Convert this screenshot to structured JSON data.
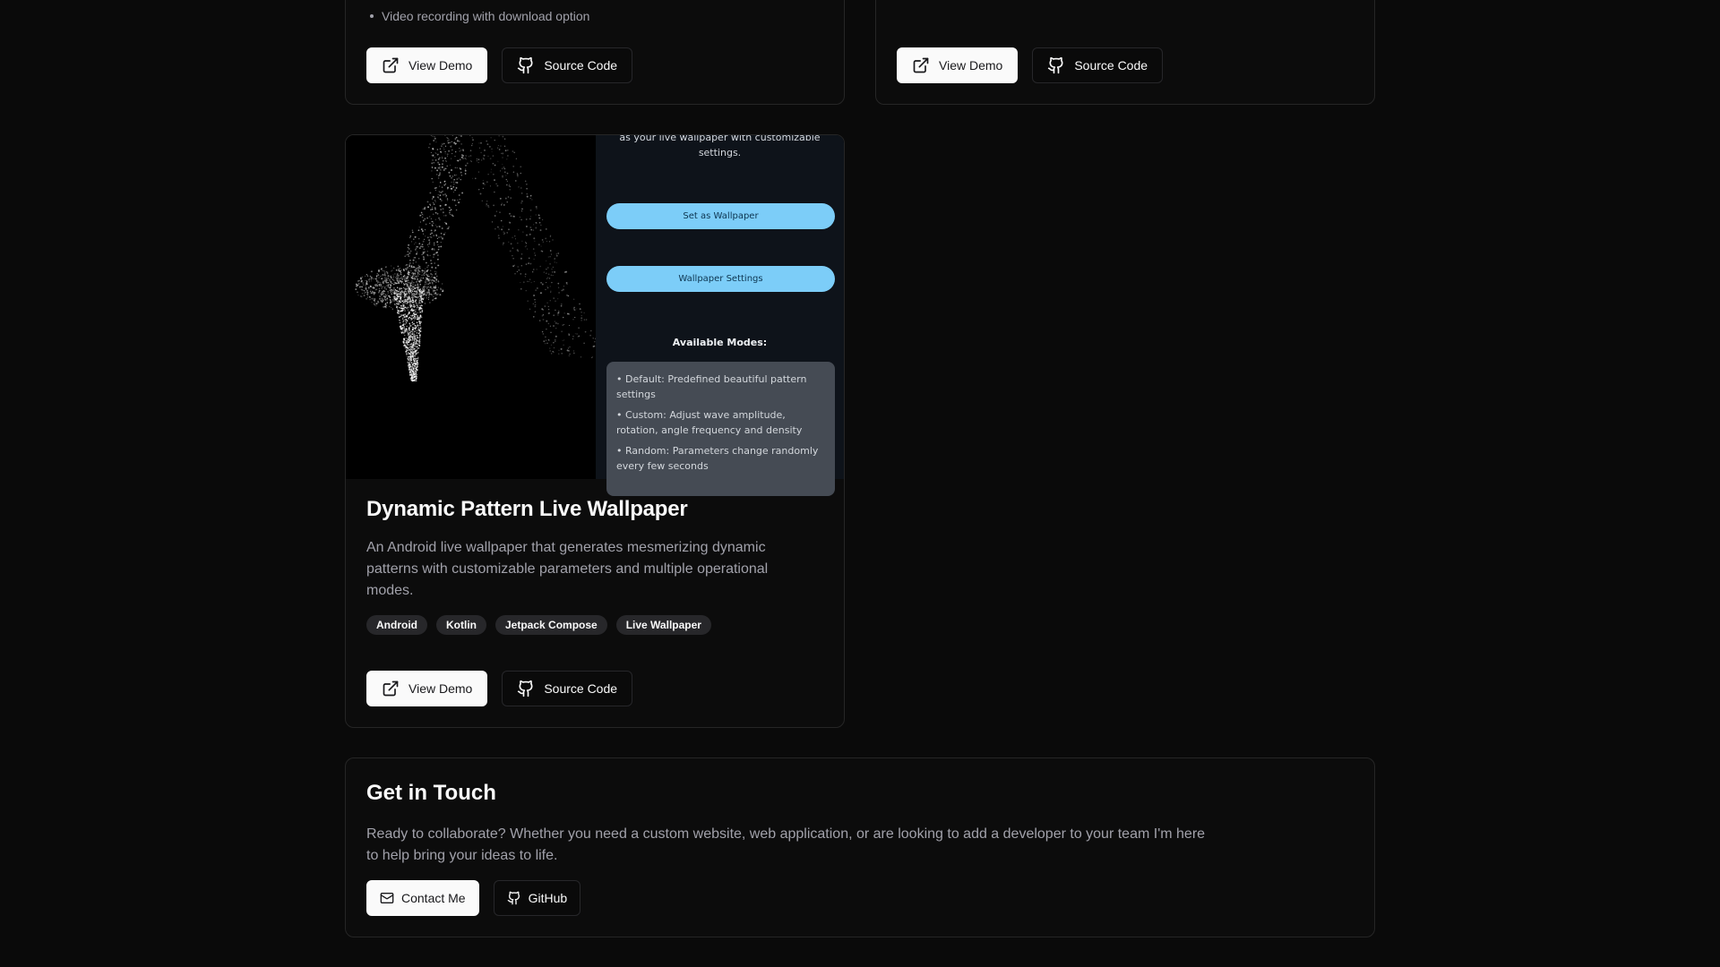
{
  "projects": [
    {
      "features": [
        "Video recording with download option"
      ],
      "buttons": {
        "demo": "View Demo",
        "source": "Source Code"
      }
    },
    {
      "buttons": {
        "demo": "View Demo",
        "source": "Source Code"
      }
    },
    {
      "title": "Dynamic Pattern Live Wallpaper",
      "description": "An Android live wallpaper that generates mesmerizing dynamic patterns with customizable parameters and multiple operational modes.",
      "tags": [
        "Android",
        "Kotlin",
        "Jetpack Compose",
        "Live Wallpaper"
      ],
      "buttons": {
        "demo": "View Demo",
        "source": "Source Code"
      },
      "preview": {
        "intro_text": "as your live wallpaper with customizable settings.",
        "set_wallpaper_label": "Set as Wallpaper",
        "wallpaper_settings_label": "Wallpaper Settings",
        "modes_title": "Available Modes:",
        "modes": [
          "• Default: Predefined beautiful pattern settings",
          "• Custom: Adjust wave amplitude, rotation, angle frequency and density",
          "• Random: Parameters change randomly every few seconds"
        ],
        "accent_color": "#7ccdf8"
      }
    }
  ],
  "contact": {
    "title": "Get in Touch",
    "description": "Ready to collaborate? Whether you need a custom website, web application, or are looking to add a developer to your team I'm here to help bring your ideas to life.",
    "contact_label": "Contact Me",
    "github_label": "GitHub"
  },
  "icons": {
    "external_link": "external-link-icon",
    "github": "github-icon",
    "mail": "mail-icon"
  },
  "theme": {
    "background": "#0a0a0a",
    "card_border": "#262626",
    "muted_text": "#a1a1aa",
    "primary_button_bg": "#fafafa"
  }
}
